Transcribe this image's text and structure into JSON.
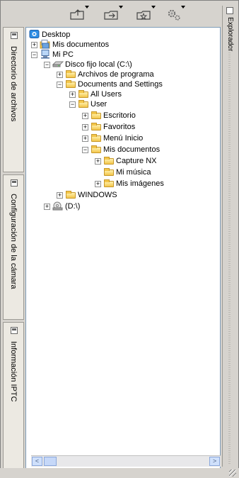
{
  "toolbar": {
    "buttons": [
      {
        "name": "folder-up-icon"
      },
      {
        "name": "folder-arrow-icon"
      },
      {
        "name": "folder-star-icon"
      },
      {
        "name": "gear-icon"
      }
    ]
  },
  "side_tabs": [
    {
      "label": "Directorio de archivos"
    },
    {
      "label": "Configuración de la cámara"
    },
    {
      "label": "Información IPTC"
    }
  ],
  "right_panel": {
    "label": "Explorador"
  },
  "tree": {
    "items": [
      {
        "label": "Desktop",
        "icon": "desktop-icon",
        "expander": ""
      },
      {
        "label": "Mis documentos",
        "icon": "documents-icon",
        "expander": "+"
      },
      {
        "label": "Mi PC",
        "icon": "computer-icon",
        "expander": "−"
      },
      {
        "label": "Disco fijo local (C:\\)",
        "icon": "drive-icon",
        "expander": "−"
      },
      {
        "label": "Archivos de programa",
        "icon": "folder-icon",
        "expander": "+"
      },
      {
        "label": "Documents and Settings",
        "icon": "folder-icon",
        "expander": "−"
      },
      {
        "label": "All Users",
        "icon": "folder-icon",
        "expander": "+"
      },
      {
        "label": "User",
        "icon": "folder-icon",
        "expander": "−"
      },
      {
        "label": "Escritorio",
        "icon": "folder-icon",
        "expander": "+"
      },
      {
        "label": "Favoritos",
        "icon": "folder-icon",
        "expander": "+"
      },
      {
        "label": "Menú Inicio",
        "icon": "folder-icon",
        "expander": "+"
      },
      {
        "label": "Mis documentos",
        "icon": "folder-icon",
        "expander": "−"
      },
      {
        "label": "Capture NX",
        "icon": "folder-icon",
        "expander": "+"
      },
      {
        "label": "Mi música",
        "icon": "folder-icon",
        "expander": ""
      },
      {
        "label": "Mis imágenes",
        "icon": "folder-icon",
        "expander": "+"
      },
      {
        "label": "WINDOWS",
        "icon": "folder-icon",
        "expander": "+"
      },
      {
        "label": "(D:\\)",
        "icon": "cd-drive-icon",
        "expander": "+"
      }
    ]
  },
  "scrollbar": {
    "left_arrow": "<",
    "right_arrow": ">"
  }
}
